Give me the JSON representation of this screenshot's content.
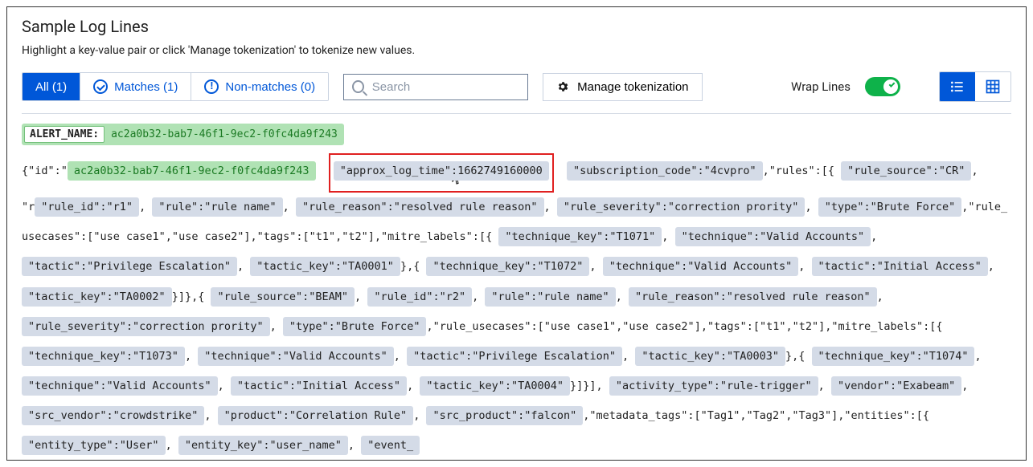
{
  "header": {
    "title": "Sample Log Lines",
    "subtitle": "Highlight a key-value pair or click 'Manage tokenization' to tokenize new values."
  },
  "tabs": {
    "all": "All (1)",
    "matches": "Matches (1)",
    "nonmatches": "Non-matches (0)"
  },
  "search": {
    "placeholder": "Search",
    "value": ""
  },
  "buttons": {
    "manage": "Manage tokenization",
    "wrap_label": "Wrap Lines"
  },
  "alert": {
    "key": "ALERT_NAME:",
    "value": "ac2a0b32-bab7-46f1-9ec2-f0fc4da9f243"
  },
  "log": {
    "p0": "{\"id\":\"",
    "id_val": "ac2a0b32-bab7-46f1-9ec2-f0fc4da9f243",
    "approx": "\"approx_log_time\":1662749160000",
    "sub": "\"subscription_code\":\"4cvpro\"",
    "p1": ",\"rules\":[{",
    "rs1": "\"rule_source\":\"CR\"",
    "ru1": "\"rule_id\":\"r1\"",
    "rn1": "\"rule\":\"rule name\"",
    "rr1": "\"rule_reason\":\"resolved rule reason\"",
    "rsev1": "\"rule_severity\":\"correction prority\"",
    "rt1": "\"type\":\"Brute Force\"",
    "p2": ",\"rule_usecases\":[\"use case1\",\"use case2\"],\"tags\":[\"t1\",\"t2\"],\"mitre_labels\":[{",
    "tk1": "\"technique_key\":\"T1071\"",
    "te1": "\"technique\":\"Valid Accounts\"",
    "ta1": "\"tactic\":\"Privilege Escalation\"",
    "tak1": "\"tactic_key\":\"TA0001\"",
    "p3": "},{",
    "tk2": "\"technique_key\":\"T1072\"",
    "te2": "\"technique\":\"Valid Accounts\"",
    "ta2": "\"tactic\":\"Initial Access\"",
    "tak2": "\"tactic_key\":\"TA0002\"",
    "p4": "}]},{",
    "rs2": "\"rule_source\":\"BEAM\"",
    "ru2": "\"rule_id\":\"r2\"",
    "rn2": "\"rule\":\"rule name\"",
    "rr2": "\"rule_reason\":\"resolved rule reason\"",
    "rsev2": "\"rule_severity\":\"correction prority\"",
    "rt2": "\"type\":\"Brute Force\"",
    "p5": ",\"rule_usecases\":[\"use case1\",\"use case2\"],\"tags\":[\"t1\",\"t2\"],\"mitre_labels\":[{",
    "tk3": "\"technique_key\":\"T1073\"",
    "te3": "\"technique\":\"Valid Accounts\"",
    "ta3": "\"tactic\":\"Privilege Escalation\"",
    "tak3": "\"tactic_key\":\"TA0003\"",
    "tk4": "\"technique_key\":\"T1074\"",
    "te4": "\"technique\":\"Valid Accounts\"",
    "ta4": "\"tactic\":\"Initial Access\"",
    "tak4": "\"tactic_key\":\"TA0004\"",
    "p6": "}]}],",
    "at": "\"activity_type\":\"rule-trigger\"",
    "ve": "\"vendor\":\"Exabeam\"",
    "sv": "\"src_vendor\":\"crowdstrike\"",
    "pr": "\"product\":\"Correlation Rule\"",
    "sp": "\"src_product\":\"falcon\"",
    "p7": ",\"metadata_tags\":[\"Tag1\",\"Tag2\",\"Tag3\"],\"entities\":[{",
    "et": "\"entity_type\":\"User\"",
    "ek": "\"entity_key\":\"user_name\"",
    "ev": "\"event_",
    "sep": ",",
    "sepbr": ", \"r"
  }
}
